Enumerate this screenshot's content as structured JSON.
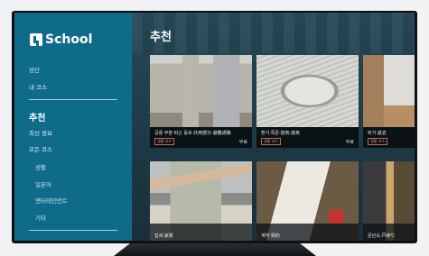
{
  "app": {
    "logo_text": "School"
  },
  "sidebar": {
    "items": [
      {
        "label": "상단"
      },
      {
        "label": "내 코스"
      }
    ],
    "section_heading": "추천",
    "sub_items": [
      {
        "label": "최신 정보"
      },
      {
        "label": "모든 코스"
      }
    ],
    "categories": [
      {
        "label": "생활"
      },
      {
        "label": "일본어"
      },
      {
        "label": "엔터테인먼트"
      },
      {
        "label": "기타"
      }
    ]
  },
  "main": {
    "title": "추천",
    "cards": [
      {
        "title": "공용 부분·퇴근 동로·共用部分·避難通路",
        "badge": "생활 코스",
        "price": "무료"
      },
      {
        "title": "환기·쪽문·換気·換気",
        "badge": "생활 코스",
        "price": "무료"
      },
      {
        "title": "퇴거·退去",
        "badge": "생활 코스",
        "price": ""
      },
      {
        "title": "집세·家賃",
        "badge": "",
        "price": ""
      },
      {
        "title": "계약·契約",
        "badge": "",
        "price": ""
      },
      {
        "title": "문단속·戸締り",
        "badge": "",
        "price": ""
      }
    ]
  },
  "colors": {
    "sidebar_bg": "#0f6b8a",
    "content_bg": "#1d3844",
    "badge_border": "#c0685a"
  }
}
